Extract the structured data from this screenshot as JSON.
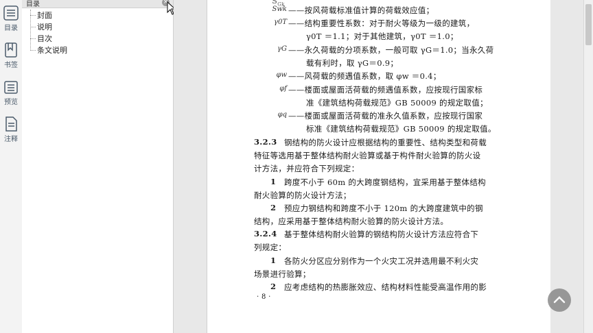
{
  "rail": {
    "items": [
      {
        "label": "目录",
        "icon": "list-icon"
      },
      {
        "label": "书签",
        "icon": "bookmark-icon"
      },
      {
        "label": "预览",
        "icon": "preview-icon"
      },
      {
        "label": "注释",
        "icon": "note-icon"
      }
    ]
  },
  "outline": {
    "title": "目录",
    "close": "×",
    "items": [
      "封面",
      "说明",
      "目次",
      "条文说明"
    ]
  },
  "page": {
    "lines": [
      {
        "sym": "Swk",
        "text": "——按风荷载标准值计算的荷载效应值；"
      },
      {
        "sym": "γ0T",
        "text": "——结构重要性系数：对于耐火等级为一级的建筑，"
      },
      {
        "sym": "",
        "text": "γ0T ＝1.1；对于其他建筑，γ0T ＝1.0；"
      },
      {
        "sym": "γG",
        "text": "——永久荷载的分项系数，一般可取 γG＝1.0；当永久荷"
      },
      {
        "sym": "",
        "text": "载有利时，取 γG＝0.9；"
      },
      {
        "sym": "φw",
        "text": "——风荷载的频遇值系数，取 φw ＝0.4；"
      },
      {
        "sym": "φf",
        "text": "——楼面或屋面活荷载的频遇值系数，应按现行国家标"
      },
      {
        "sym": "",
        "text": "准《建筑结构荷载规范》GB 50009 的规定取值；"
      },
      {
        "sym": "φq",
        "text": "——楼面或屋面活荷载的准永久值系数，应按现行国家"
      },
      {
        "sym": "",
        "text": "标准《建筑结构荷载规范》GB 50009 的规定取值。"
      }
    ],
    "paragraphs": [
      {
        "num": "3.2.3",
        "text": "钢结构的防火设计应根据结构的重要性、结构类型和荷载"
      },
      {
        "num": "",
        "text": "特征等选用基于整体结构耐火验算或基于构件耐火验算的防火设"
      },
      {
        "num": "",
        "text": "计方法，并应符合下列规定："
      },
      {
        "num": "1",
        "text": "跨度不小于 60m 的大跨度钢结构，宜采用基于整体结构"
      },
      {
        "num": "",
        "text": "耐火验算的防火设计方法；"
      },
      {
        "num": "2",
        "text": "预应力钢结构和跨度不小于 120m 的大跨度建筑中的钢"
      },
      {
        "num": "",
        "text": "结构，应采用基于整体结构耐火验算的防火设计方法。"
      },
      {
        "num": "3.2.4",
        "text": "基于整体结构耐火验算的钢结构防火设计方法应符合下"
      },
      {
        "num": "",
        "text": "列规定："
      },
      {
        "num": "1",
        "text": "各防火分区应分别作为一个火灾工况并选用最不利火灾"
      },
      {
        "num": "",
        "text": "场景进行验算；"
      },
      {
        "num": "2",
        "text": "应考虑结构的热膨胀效应、结构材料性能受高温作用的影"
      }
    ],
    "page_number": "· 8 ·"
  }
}
